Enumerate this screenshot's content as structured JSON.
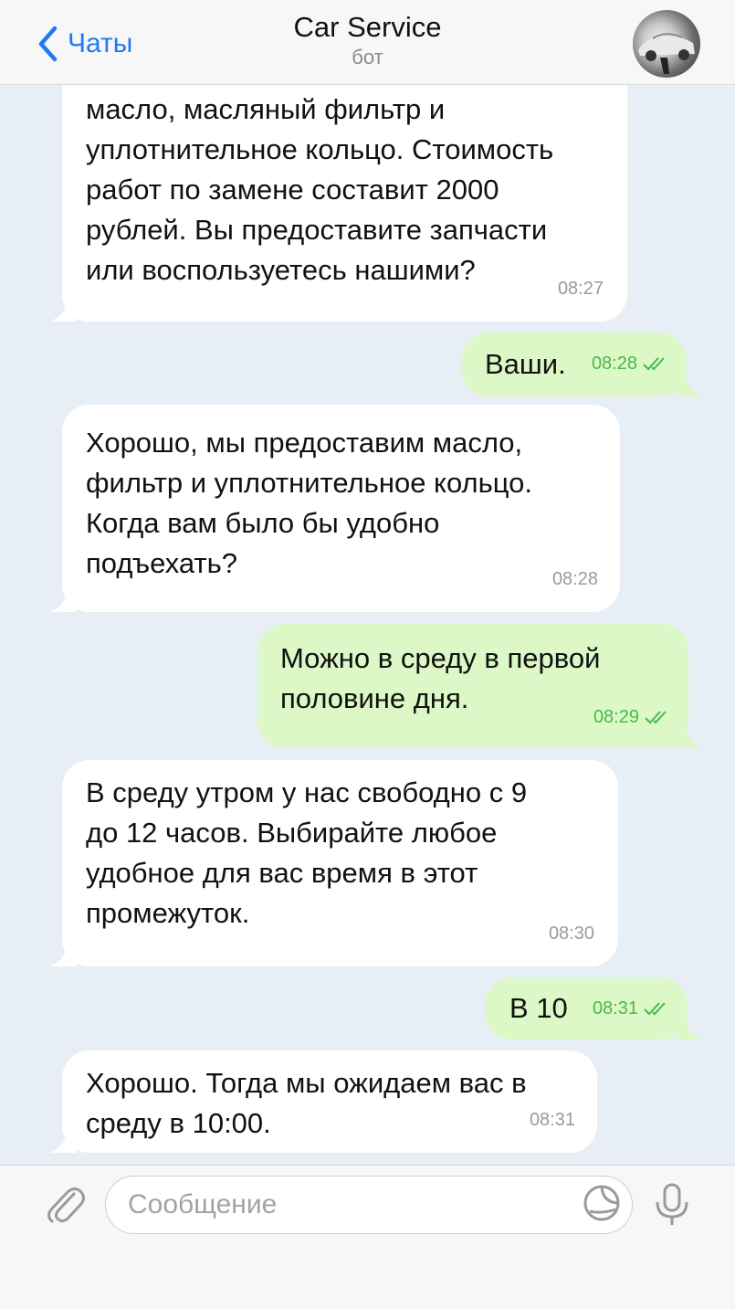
{
  "header": {
    "back_label": "Чаты",
    "title": "Car Service",
    "subtitle": "бот"
  },
  "messages": [
    {
      "direction": "in",
      "text": "масло, масляный фильтр и\nуплотнительное кольцо. Стоимость\nработ по замене составит 2000\nрублей. Вы предоставите запчасти\nили воспользуетесь нашими?",
      "time": "08:27"
    },
    {
      "direction": "out",
      "text": "Ваши.",
      "time": "08:28",
      "read": true
    },
    {
      "direction": "in",
      "text": "Хорошо, мы предоставим масло,\nфильтр и уплотнительное кольцо.\nКогда вам было бы удобно\nподъехать?",
      "time": "08:28"
    },
    {
      "direction": "out",
      "text": "Можно в среду в первой\nполовине дня.",
      "time": "08:29",
      "read": true
    },
    {
      "direction": "in",
      "text": "В среду утром у нас свободно с 9\nдо 12 часов. Выбирайте любое\nудобное для вас время в этот\nпромежуток.",
      "time": "08:30"
    },
    {
      "direction": "out",
      "text": "В 10",
      "time": "08:31",
      "read": true
    },
    {
      "direction": "in",
      "text": "Хорошо. Тогда мы ожидаем вас в\nсреду в 10:00.",
      "time": "08:31"
    }
  ],
  "composer": {
    "placeholder": "Сообщение"
  },
  "icons": {
    "back": "chevron-left-icon",
    "attach": "paperclip-icon",
    "sticker": "sticker-icon",
    "mic": "microphone-icon",
    "read_status": "double-check-icon"
  },
  "colors": {
    "accent": "#1e7cf2",
    "outgoing_bubble": "#dcf8c6",
    "incoming_bubble": "#ffffff",
    "chat_background": "#e8eef5",
    "read_check": "#49b94c"
  }
}
